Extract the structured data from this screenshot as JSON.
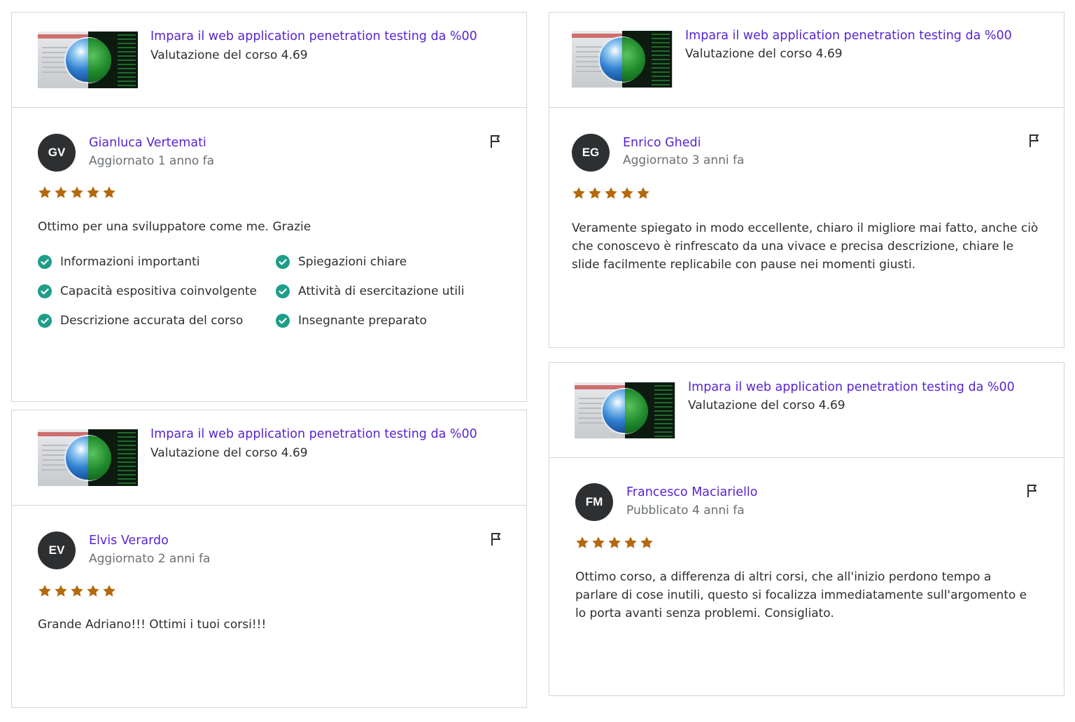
{
  "course": {
    "title": "Impara il web application penetration testing da %00",
    "rating_label": "Valutazione del corso 4.69"
  },
  "colors": {
    "accent": "#5624d0",
    "star": "#b4690e",
    "check": "#1e9e89",
    "avatar": "#2d2f31"
  },
  "reviews": [
    {
      "initials": "GV",
      "name": "Gianluca Vertemati",
      "date": "Aggiornato 1 anno fa",
      "rating": 5,
      "text": "Ottimo per una sviluppatore come me. Grazie",
      "tags": [
        "Informazioni importanti",
        "Spiegazioni chiare",
        "Capacità espositiva coinvolgente",
        "Attività di esercitazione utili",
        "Descrizione accurata del corso",
        "Insegnante preparato"
      ]
    },
    {
      "initials": "EG",
      "name": "Enrico Ghedi",
      "date": "Aggiornato 3 anni fa",
      "rating": 5,
      "text": "Veramente spiegato in modo eccellente, chiaro il migliore mai fatto, anche ciò che conoscevo è rinfrescato da una vivace e precisa descrizione, chiare le slide facilmente replicabile con pause nei momenti giusti."
    },
    {
      "initials": "EV",
      "name": "Elvis Verardo",
      "date": "Aggiornato 2 anni fa",
      "rating": 5,
      "text": "Grande Adriano!!! Ottimi i tuoi corsi!!!"
    },
    {
      "initials": "FM",
      "name": "Francesco Maciariello",
      "date": "Pubblicato 4 anni fa",
      "rating": 5,
      "text": "Ottimo corso, a differenza di altri corsi, che all'inizio perdono tempo a parlare di cose inutili, questo si focalizza immediatamente sull'argomento e lo porta avanti senza problemi. Consigliato."
    }
  ]
}
